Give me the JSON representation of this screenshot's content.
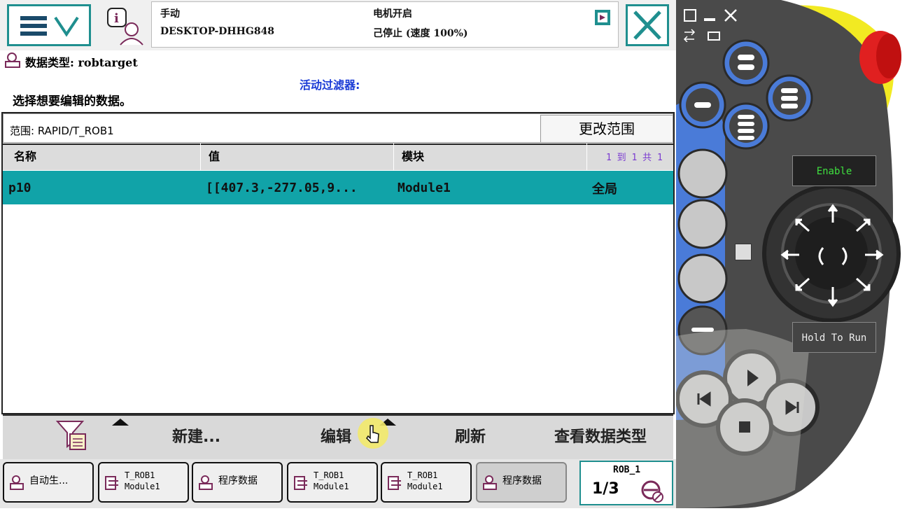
{
  "status": {
    "mode": "手动",
    "controller": "DESKTOP-DHHG848",
    "motor": "电机开启",
    "state": "己停止 (速度 100%)"
  },
  "data_type_label": "数据类型: robtarget",
  "active_filter": "活动过滤器:",
  "instruction": "选择想要编辑的数据。",
  "scope": {
    "label": "范围: RAPID/T_ROB1",
    "change_button": "更改范围"
  },
  "table": {
    "columns": [
      "名称",
      "值",
      "模块"
    ],
    "pagination": "1 到 1 共 1",
    "rows": [
      {
        "name": "p10",
        "value": "[[407.3,-277.05,9...",
        "module": "Module1",
        "scope": "全局"
      }
    ]
  },
  "toolbar": {
    "new": "新建...",
    "edit": "编辑",
    "refresh": "刷新",
    "view_type": "查看数据类型"
  },
  "tasks": [
    {
      "line1": "自动生...",
      "line2": ""
    },
    {
      "line1": "T_ROB1",
      "line2": "Module1"
    },
    {
      "line1": "程序数据",
      "line2": ""
    },
    {
      "line1": "T_ROB1",
      "line2": "Module1"
    },
    {
      "line1": "T_ROB1",
      "line2": "Module1"
    },
    {
      "line1": "程序数据",
      "line2": ""
    }
  ],
  "robot": {
    "name": "ROB_1",
    "fraction": "1/3"
  },
  "pendant": {
    "enable_label": "Enable",
    "hold_label": "Hold To Run"
  },
  "colors": {
    "accent": "#1f8f8f",
    "row_selected": "#11a3a8",
    "filter_text": "#1a3bd6",
    "pendant_blue": "#4a7bd8",
    "estop_red": "#e02020",
    "guard_yellow": "#f2ea22"
  }
}
